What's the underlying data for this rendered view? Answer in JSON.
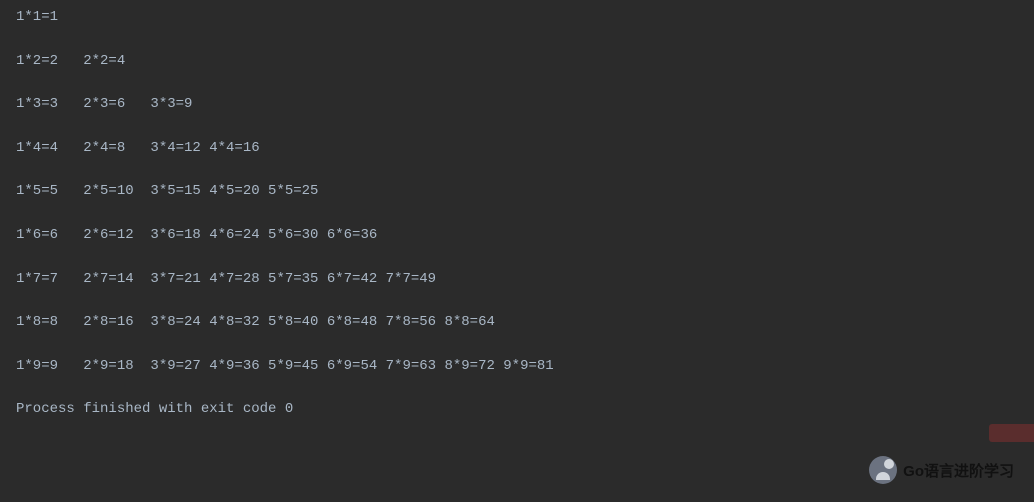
{
  "output": {
    "lines": [
      "1*1=1",
      "1*2=2   2*2=4",
      "1*3=3   2*3=6   3*3=9",
      "1*4=4   2*4=8   3*4=12 4*4=16",
      "1*5=5   2*5=10  3*5=15 4*5=20 5*5=25",
      "1*6=6   2*6=12  3*6=18 4*6=24 5*6=30 6*6=36",
      "1*7=7   2*7=14  3*7=21 4*7=28 5*7=35 6*7=42 7*7=49",
      "1*8=8   2*8=16  3*8=24 4*8=32 5*8=40 6*8=48 7*8=56 8*8=64",
      "1*9=9   2*9=18  3*9=27 4*9=36 5*9=45 6*9=54 7*9=63 8*9=72 9*9=81"
    ],
    "process_message": "Process finished with exit code 0"
  },
  "watermark": {
    "text": "Go语言进阶学习"
  },
  "chart_data": {
    "type": "table",
    "title": "Multiplication Table 1-9",
    "rows": [
      [
        {
          "a": 1,
          "b": 1,
          "product": 1
        }
      ],
      [
        {
          "a": 1,
          "b": 2,
          "product": 2
        },
        {
          "a": 2,
          "b": 2,
          "product": 4
        }
      ],
      [
        {
          "a": 1,
          "b": 3,
          "product": 3
        },
        {
          "a": 2,
          "b": 3,
          "product": 6
        },
        {
          "a": 3,
          "b": 3,
          "product": 9
        }
      ],
      [
        {
          "a": 1,
          "b": 4,
          "product": 4
        },
        {
          "a": 2,
          "b": 4,
          "product": 8
        },
        {
          "a": 3,
          "b": 4,
          "product": 12
        },
        {
          "a": 4,
          "b": 4,
          "product": 16
        }
      ],
      [
        {
          "a": 1,
          "b": 5,
          "product": 5
        },
        {
          "a": 2,
          "b": 5,
          "product": 10
        },
        {
          "a": 3,
          "b": 5,
          "product": 15
        },
        {
          "a": 4,
          "b": 5,
          "product": 20
        },
        {
          "a": 5,
          "b": 5,
          "product": 25
        }
      ],
      [
        {
          "a": 1,
          "b": 6,
          "product": 6
        },
        {
          "a": 2,
          "b": 6,
          "product": 12
        },
        {
          "a": 3,
          "b": 6,
          "product": 18
        },
        {
          "a": 4,
          "b": 6,
          "product": 24
        },
        {
          "a": 5,
          "b": 6,
          "product": 30
        },
        {
          "a": 6,
          "b": 6,
          "product": 36
        }
      ],
      [
        {
          "a": 1,
          "b": 7,
          "product": 7
        },
        {
          "a": 2,
          "b": 7,
          "product": 14
        },
        {
          "a": 3,
          "b": 7,
          "product": 21
        },
        {
          "a": 4,
          "b": 7,
          "product": 28
        },
        {
          "a": 5,
          "b": 7,
          "product": 35
        },
        {
          "a": 6,
          "b": 7,
          "product": 42
        },
        {
          "a": 7,
          "b": 7,
          "product": 49
        }
      ],
      [
        {
          "a": 1,
          "b": 8,
          "product": 8
        },
        {
          "a": 2,
          "b": 8,
          "product": 16
        },
        {
          "a": 3,
          "b": 8,
          "product": 24
        },
        {
          "a": 4,
          "b": 8,
          "product": 32
        },
        {
          "a": 5,
          "b": 8,
          "product": 40
        },
        {
          "a": 6,
          "b": 8,
          "product": 48
        },
        {
          "a": 7,
          "b": 8,
          "product": 56
        },
        {
          "a": 8,
          "b": 8,
          "product": 64
        }
      ],
      [
        {
          "a": 1,
          "b": 9,
          "product": 9
        },
        {
          "a": 2,
          "b": 9,
          "product": 18
        },
        {
          "a": 3,
          "b": 9,
          "product": 27
        },
        {
          "a": 4,
          "b": 9,
          "product": 36
        },
        {
          "a": 5,
          "b": 9,
          "product": 45
        },
        {
          "a": 6,
          "b": 9,
          "product": 54
        },
        {
          "a": 7,
          "b": 9,
          "product": 63
        },
        {
          "a": 8,
          "b": 9,
          "product": 72
        },
        {
          "a": 9,
          "b": 9,
          "product": 81
        }
      ]
    ]
  }
}
